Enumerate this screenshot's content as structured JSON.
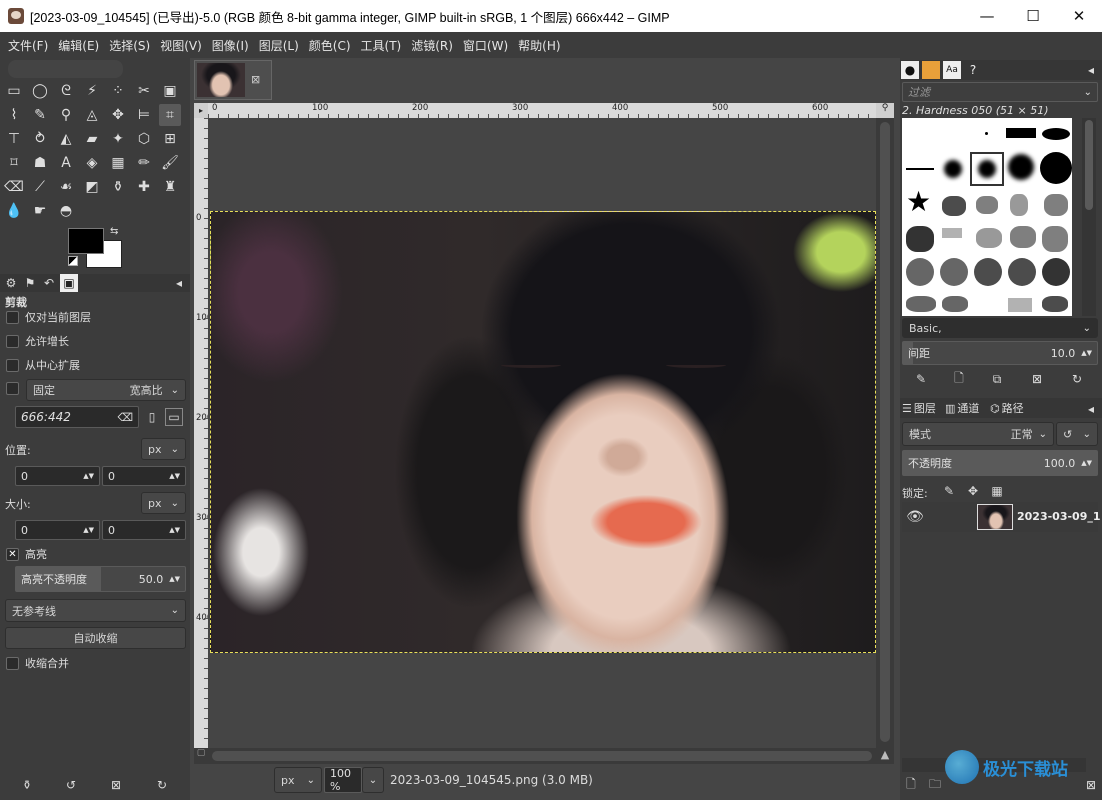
{
  "window": {
    "title": "[2023-03-09_104545] (已导出)-5.0 (RGB 颜色 8-bit gamma integer, GIMP built-in sRGB, 1 个图层) 666x442 – GIMP",
    "minimize": "—",
    "maximize": "☐",
    "close": "✕"
  },
  "menu": [
    "文件(F)",
    "编辑(E)",
    "选择(S)",
    "视图(V)",
    "图像(I)",
    "图层(L)",
    "颜色(C)",
    "工具(T)",
    "滤镜(R)",
    "窗口(W)",
    "帮助(H)"
  ],
  "tool_options": {
    "title": "剪裁",
    "current_layer_only": "仅对当前图层",
    "allow_growing": "允许增长",
    "expand_from_center": "从中心扩展",
    "fixed_label": "固定",
    "fixed_mode": "宽高比",
    "ratio_value": "666:442",
    "position_label": "位置:",
    "position_unit": "px",
    "pos_x": "0",
    "pos_y": "0",
    "size_label": "大小:",
    "size_unit": "px",
    "size_w": "0",
    "size_h": "0",
    "highlight_label": "高亮",
    "highlight_opacity_label": "高亮不透明度",
    "highlight_opacity_value": "50.0",
    "guides": "无参考线",
    "auto_shrink": "自动收缩",
    "shrink_merged": "收缩合并"
  },
  "rulers": {
    "h_labels": [
      "0",
      "100",
      "200",
      "300",
      "400",
      "500",
      "600"
    ],
    "v_labels": [
      "0",
      "100",
      "200",
      "300",
      "400"
    ]
  },
  "status": {
    "unit": "px",
    "zoom": "100 %",
    "file": "2023-03-09_104545.png (3.0 MB)"
  },
  "brushes": {
    "filter_placeholder": "过滤",
    "current": "2. Hardness 050 (51 × 51)",
    "preset": "Basic,",
    "spacing_label": "间距",
    "spacing_value": "10.0"
  },
  "layers": {
    "tab_layers": "图层",
    "tab_channels": "通道",
    "tab_paths": "路径",
    "mode_label": "模式",
    "mode_value": "正常",
    "opacity_label": "不透明度",
    "opacity_value": "100.0",
    "lock_label": "锁定:",
    "layer_name": "2023-03-09_1"
  },
  "watermark": "极光下载站"
}
